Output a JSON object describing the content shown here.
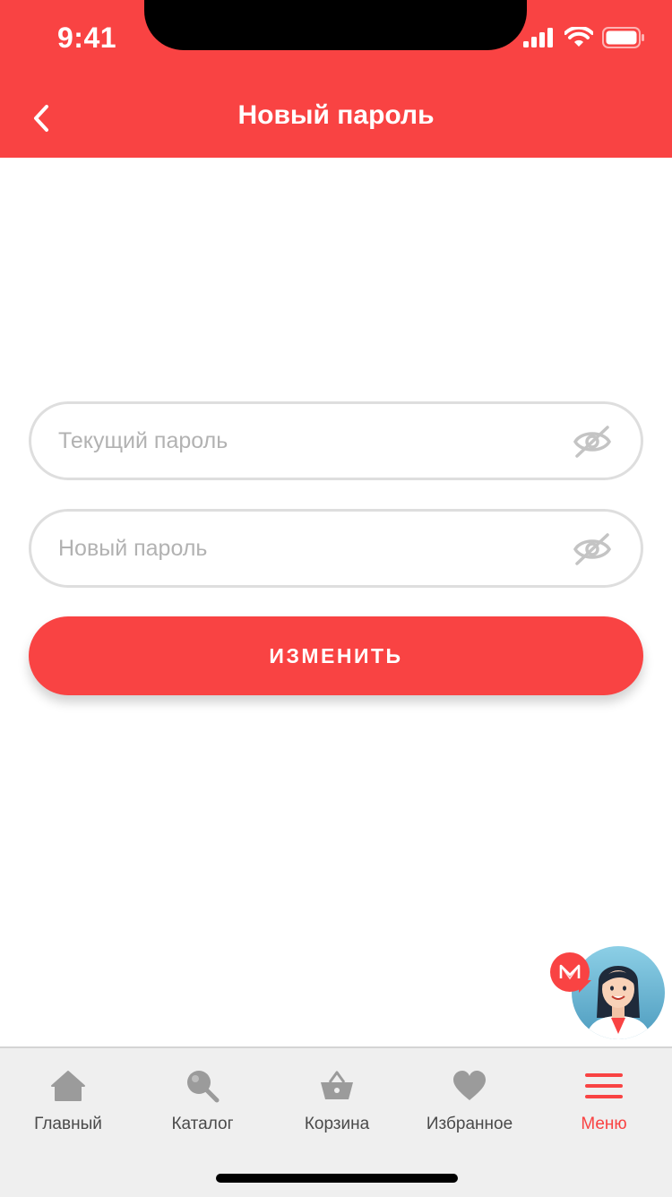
{
  "status_bar": {
    "time": "9:41"
  },
  "header": {
    "title": "Новый пароль"
  },
  "form": {
    "current_password_placeholder": "Текущий пароль",
    "new_password_placeholder": "Новый пароль",
    "submit_label": "ИЗМЕНИТЬ"
  },
  "tabbar": {
    "items": [
      {
        "label": "Главный",
        "icon": "home-icon"
      },
      {
        "label": "Каталог",
        "icon": "search-icon"
      },
      {
        "label": "Корзина",
        "icon": "basket-icon"
      },
      {
        "label": "Избранное",
        "icon": "heart-icon"
      },
      {
        "label": "Меню",
        "icon": "menu-icon",
        "active": true
      }
    ]
  },
  "colors": {
    "accent": "#F94343",
    "field_border": "#DEDEDE",
    "placeholder": "#B2B2B2",
    "tab_icon": "#9B9B9B"
  }
}
